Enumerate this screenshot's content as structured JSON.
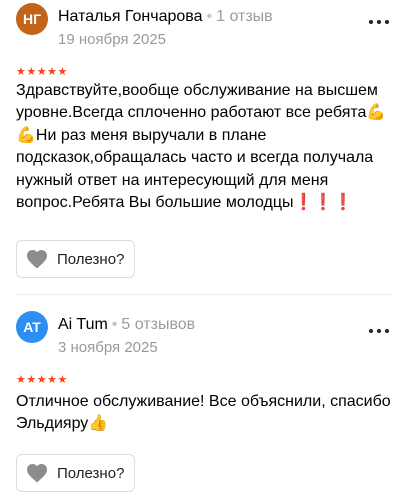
{
  "reviews": [
    {
      "avatar_initials": "НГ",
      "avatar_color": "#c2651a",
      "name": "Наталья Гончарова",
      "reviews_count": "1 отзыв",
      "date": "19 ноября 2025",
      "rating": "★★★★★",
      "text": "Здравствуйте,вообще обслуживание на высшем уровне.Всегда сплоченно работают все ребята💪💪Ни раз меня выручали в плане подсказок,обращалась часто и всегда получала нужный ответ на интересующий для меня вопрос.Ребята Вы большие молодцы❗❗❗",
      "helpful_label": "Полезно?"
    },
    {
      "avatar_initials": "AT",
      "avatar_color": "#2b8ef0",
      "name": "Ai Tum",
      "reviews_count": "5 отзывов",
      "date": "3 ноября 2025",
      "rating": "★★★★★",
      "text": "Отличное обслуживание! Все объяснили, спасибо Эльдияру👍",
      "helpful_label": "Полезно?"
    }
  ],
  "colors": {
    "star": "#fc3f1d",
    "secondary_text": "#999999",
    "heart": "#8c8c8c"
  },
  "icons": {
    "more": "more-dots-icon",
    "helpful": "heart-icon"
  }
}
